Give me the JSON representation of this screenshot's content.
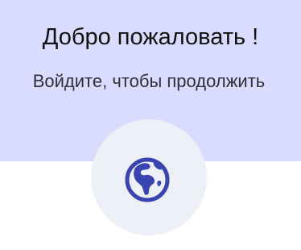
{
  "welcome": {
    "title": "Добро пожаловать !",
    "subtitle": "Войдите, чтобы продолжить"
  },
  "logo": {
    "icon": "globe-africa-icon",
    "icon_color": "#3a44b0",
    "circle_color": "#edf0f6"
  },
  "colors": {
    "header_bg": "#d9dcff",
    "page_bg": "#ffffff"
  }
}
